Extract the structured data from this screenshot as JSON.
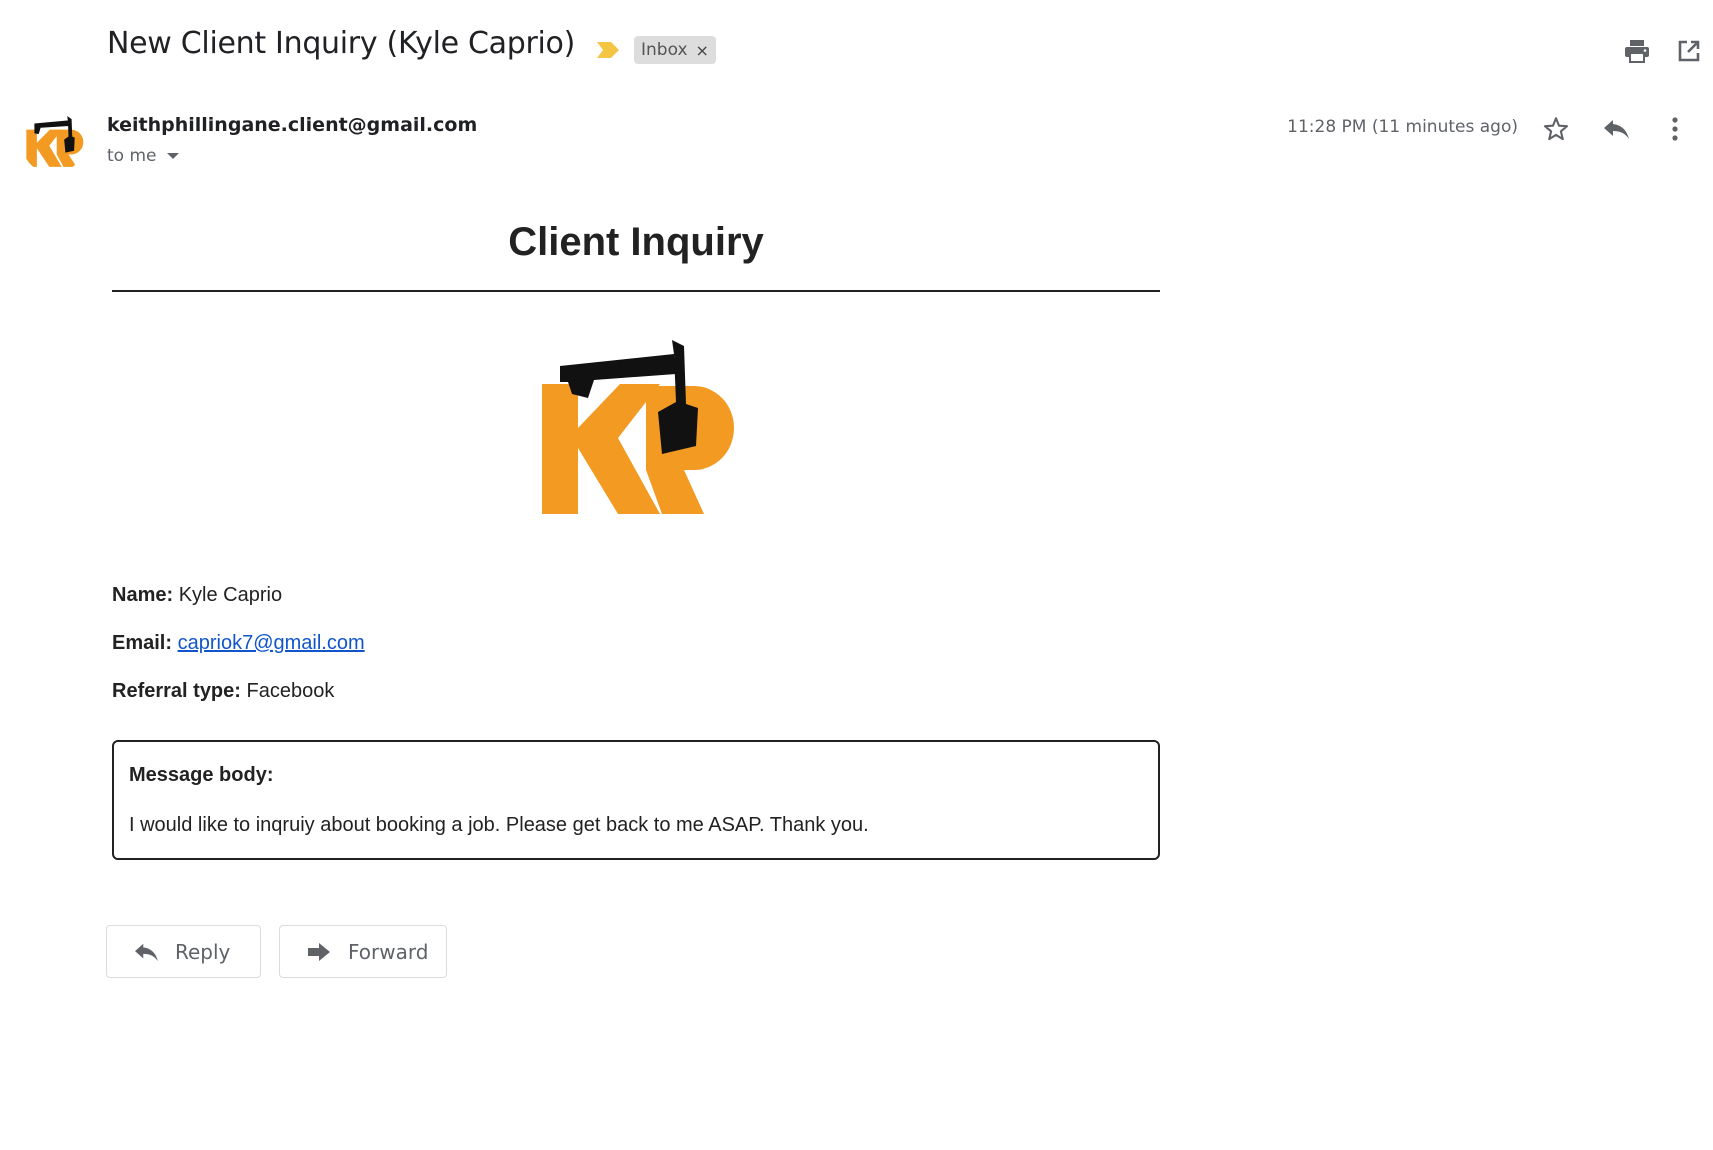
{
  "header": {
    "subject": "New Client Inquiry (Kyle Caprio)",
    "label": "Inbox",
    "label_remove": "×",
    "importance_color": "#f4c542"
  },
  "sender": {
    "address": "keithphillingane.client@gmail.com",
    "recipient": "to me",
    "timestamp": "11:28 PM (11 minutes ago)"
  },
  "icons": {
    "print": "print-icon",
    "open_new_window": "open-in-new-icon",
    "star": "star-icon",
    "reply": "reply-icon",
    "more": "more-vertical-icon",
    "forward": "forward-icon"
  },
  "body": {
    "title": "Client Inquiry",
    "logo_text": "KP",
    "logo_color": "#f39a22",
    "name_label": "Name:",
    "name_value": "Kyle Caprio",
    "email_label": "Email:",
    "email_value": "capriok7@gmail.com",
    "referral_label": "Referral type:",
    "referral_value": "Facebook",
    "message_label": "Message body:",
    "message_text": "I would like to inqruiy about booking a job. Please get back to me ASAP. Thank you."
  },
  "actions": {
    "reply_label": "Reply",
    "forward_label": "Forward"
  }
}
